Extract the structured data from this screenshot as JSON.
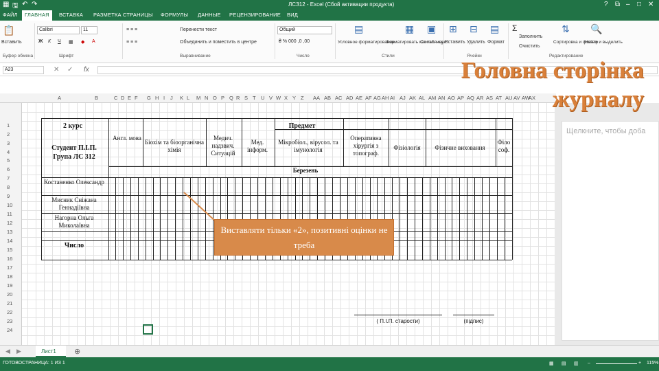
{
  "window": {
    "title": "ЛСЗ12 - Excel (Сбой активации продукта)",
    "controls": [
      "?",
      "⧉",
      "–",
      "□",
      "✕"
    ]
  },
  "menu": [
    "ФАЙЛ",
    "ГЛАВНАЯ",
    "ВСТАВКА",
    "РАЗМЕТКА СТРАНИЦЫ",
    "ФОРМУЛЫ",
    "ДАННЫЕ",
    "РЕЦЕНЗИРОВАНИЕ",
    "ВИД"
  ],
  "ribbon": {
    "paste": "Вставить",
    "clipboard": "Буфер обмена",
    "font_name": "Calibri",
    "font_size": "11",
    "font_group": "Шрифт",
    "wrap_text": "Перенести текст",
    "merge": "Объединить и поместить в центре",
    "alignment_group": "Выравнивание",
    "number_format": "Общий",
    "number_group": "Число",
    "cond_format": "Условное форматирование",
    "format_table": "Форматировать как таблицу",
    "cell_styles": "Стили ячеек",
    "styles_group": "Стили",
    "insert": "Вставить",
    "delete": "Удалить",
    "format": "Формат",
    "cells_group": "Ячейки",
    "autosum": "Σ",
    "fill": "Заполнить",
    "clear": "Очистить",
    "sort": "Сортировка и фильтр",
    "find": "Найти и выделить",
    "editing_group": "Редактирование"
  },
  "formula_bar": {
    "name_box": "A23",
    "fx": "fx",
    "cancel": "✕",
    "confirm": "✓"
  },
  "columns": [
    "A",
    "B",
    "C",
    "D",
    "E",
    "F",
    "G",
    "H",
    "I",
    "J",
    "K",
    "L",
    "M",
    "N",
    "O",
    "P",
    "Q",
    "R",
    "S",
    "T",
    "U",
    "V",
    "W",
    "X",
    "Y",
    "Z",
    "AA",
    "AB",
    "AC",
    "AD",
    "AE",
    "AF",
    "AG",
    "AH",
    "AI",
    "AJ",
    "AK",
    "AL",
    "AM",
    "AN",
    "AO",
    "AP",
    "AQ",
    "AR",
    "AS",
    "AT",
    "AU",
    "AV",
    "AW",
    "AX"
  ],
  "rows": [
    "1",
    "2",
    "3",
    "4",
    "5",
    "6",
    "7",
    "8",
    "9",
    "10",
    "11",
    "12",
    "13",
    "14",
    "15",
    "16",
    "17",
    "18",
    "19",
    "20",
    "21",
    "22",
    "23",
    "24"
  ],
  "table": {
    "course": "2 курс",
    "student": "Студент П.І.П.",
    "group": "Група ЛС 312",
    "subject_header": "Предмет",
    "month": "Березень",
    "number_label": "Число",
    "subjects": [
      "Англ. мова",
      "Біохім та біоорганічна хімія",
      "Медич. надзвич. Ситуацій",
      "Мед. інформ.",
      "Мікробіол., вірусол. та імунологія",
      "Оперативна хірургія з топограф.",
      "Фізіологія",
      "Фізичне виховання",
      "Філо соф."
    ],
    "students": [
      "Костаненко Олександр",
      "Мисник Сніжана Геннадіївна",
      "Нагорна Ольга Миколаївна"
    ],
    "signature_starosta": "( П.І.П. старости)",
    "signature_pidpys": "(підпис)"
  },
  "overlay": {
    "title_line1": "Головна сторінка",
    "title_line2": "журналу",
    "callout": "Виставляти тільки «2», позитивні оцінки не треба",
    "notes_hint": "Щелкните, чтобы доба"
  },
  "sheet_tab": "Лист1",
  "status": {
    "ready": "ГОТОВО",
    "page": "СТРАНИЦА: 1 ИЗ 1",
    "zoom": "115%"
  },
  "colors": {
    "excel_green": "#217346",
    "callout_orange": "#d88a4a",
    "title_orange": "#d9803a"
  }
}
